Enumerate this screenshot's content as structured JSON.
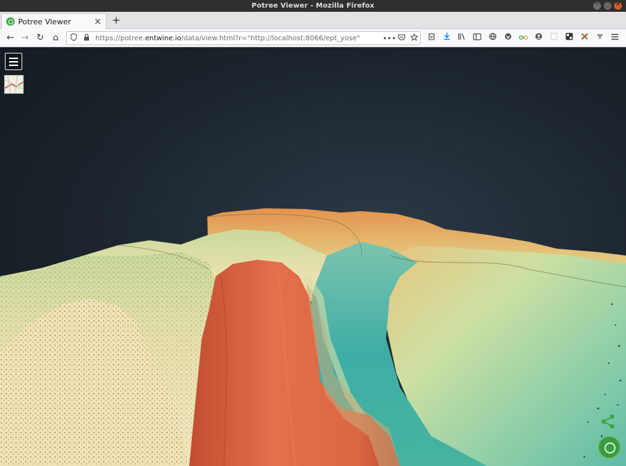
{
  "window": {
    "title": "Potree Viewer - Mozilla Firefox"
  },
  "tabs": [
    {
      "label": "Potree Viewer",
      "close": "×"
    }
  ],
  "toolbar": {
    "new_tab": "+",
    "back": "←",
    "forward": "→",
    "reload": "↻",
    "home": "⌂",
    "url_prefix": "https://potree.",
    "url_domain": "entwine.io",
    "url_suffix": "/data/view.html?r=\"http://localhost:8066/ept_yose\"",
    "page_actions": "•••"
  },
  "icons": {
    "tracking": "shield-icon",
    "lock": "lock-icon",
    "pocket": "pocket-icon",
    "bookmark": "star-icon",
    "downloads": "download-icon",
    "library": "library-icon",
    "sidebar": "sidebar-icon",
    "menu": "hamburger-icon"
  },
  "viewer": {
    "menu_button": "menu",
    "share": "share-icon",
    "logo": "potree-logo-icon"
  },
  "colors": {
    "background": "#1b242c",
    "accent_green": "#3b9b43",
    "terrain_high": "#d9663f",
    "terrain_low": "#3fb0a8"
  }
}
